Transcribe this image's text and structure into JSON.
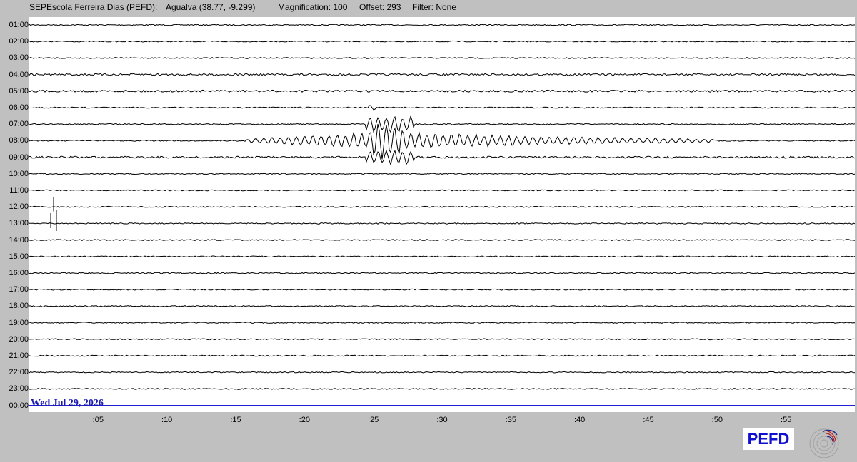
{
  "header": {
    "station": "SEPEscola Ferreira Dias (PEFD):",
    "location": "Agualva (38.77, -9.299)",
    "magnification": "Magnification: 100",
    "offset": "Offset: 293",
    "filter": "Filter: None"
  },
  "hours": [
    "01:00",
    "02:00",
    "03:00",
    "04:00",
    "05:00",
    "06:00",
    "07:00",
    "08:00",
    "09:00",
    "10:00",
    "11:00",
    "12:00",
    "13:00",
    "14:00",
    "15:00",
    "16:00",
    "17:00",
    "18:00",
    "19:00",
    "20:00",
    "21:00",
    "22:00",
    "23:00",
    "00:00"
  ],
  "minutes": [
    ":05",
    ":10",
    ":15",
    ":20",
    ":25",
    ":30",
    ":35",
    ":40",
    ":45",
    ":50",
    ":55"
  ],
  "date": "Wed Jul 29, 2026",
  "logo": "PEFD",
  "colors": {
    "background": "#c0c0c0",
    "plot_background": "#ffffff",
    "trace": "#000000",
    "current_line": "#0000cc",
    "date_text": "#1a1ab0",
    "logo_text": "#1010d0"
  }
}
